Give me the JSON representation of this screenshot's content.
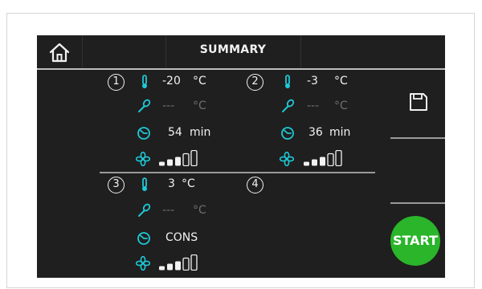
{
  "header": {
    "title": "SUMMARY"
  },
  "colors": {
    "accent": "#1ec8d6",
    "start": "#2ab52a",
    "background": "#1f1f1f",
    "dim": "#6e6e6e"
  },
  "zones": [
    {
      "number": "1",
      "temp_value": "-20",
      "temp_unit": "°C",
      "probe_value": "---",
      "probe_unit": "°C",
      "time_value": "54",
      "time_unit": "min",
      "fan_level": 3,
      "fan_max": 5
    },
    {
      "number": "2",
      "temp_value": "-3",
      "temp_unit": "°C",
      "probe_value": "---",
      "probe_unit": "°C",
      "time_value": "36",
      "time_unit": "min",
      "fan_level": 3,
      "fan_max": 5
    },
    {
      "number": "3",
      "temp_value": "3",
      "temp_unit": "°C",
      "probe_value": "---",
      "probe_unit": "°C",
      "time_value": "CONS",
      "fan_level": 3,
      "fan_max": 5
    },
    {
      "number": "4"
    }
  ],
  "sidebar": {
    "save_icon": "save-icon",
    "start_label": "START"
  }
}
